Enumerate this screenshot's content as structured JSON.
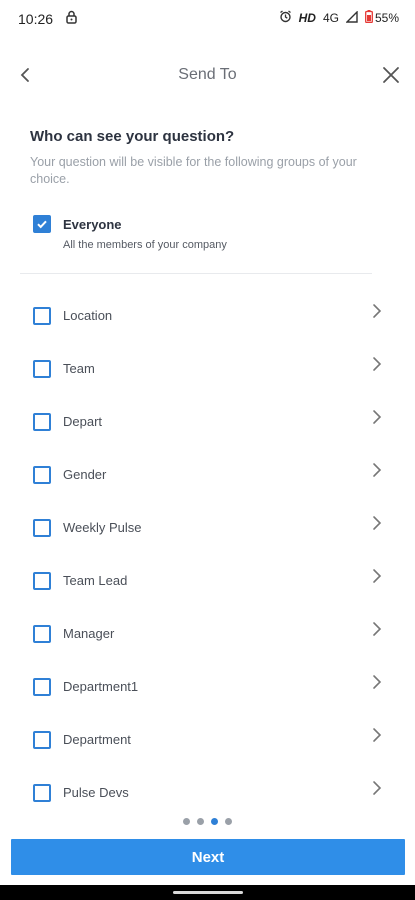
{
  "status_bar": {
    "time": "10:26",
    "network_hd": "HD",
    "network_type": "4G",
    "battery": "55%",
    "icons": [
      "lock-icon",
      "alarm-icon",
      "signal-icon",
      "battery-icon"
    ]
  },
  "header": {
    "title": "Send To",
    "back_icon": "chevron-left-icon",
    "close_icon": "close-icon"
  },
  "intro": {
    "title": "Who can see your question?",
    "subtitle": "Your question will be visible for the following groups of your choice."
  },
  "everyone": {
    "label": "Everyone",
    "description": "All the members of your company",
    "checked": true
  },
  "groups": [
    {
      "label": "Location",
      "checked": false
    },
    {
      "label": "Team",
      "checked": false
    },
    {
      "label": "Depart",
      "checked": false
    },
    {
      "label": "Gender",
      "checked": false
    },
    {
      "label": "Weekly Pulse",
      "checked": false
    },
    {
      "label": "Team Lead",
      "checked": false
    },
    {
      "label": "Manager",
      "checked": false
    },
    {
      "label": "Department1",
      "checked": false
    },
    {
      "label": "Department",
      "checked": false
    },
    {
      "label": "Pulse Devs",
      "checked": false
    }
  ],
  "pager": {
    "count": 4,
    "active_index": 2
  },
  "footer": {
    "next_label": "Next"
  },
  "colors": {
    "accent": "#2f80d6",
    "button": "#2f8ee8",
    "battery_low": "#e53935"
  }
}
